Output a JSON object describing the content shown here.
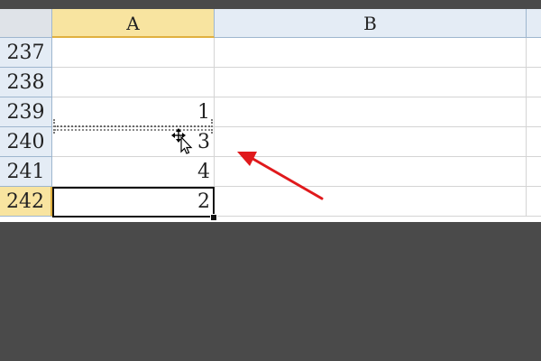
{
  "columns": [
    {
      "label": "A"
    },
    {
      "label": "B"
    }
  ],
  "rows": [
    {
      "number": "237",
      "a": ""
    },
    {
      "number": "238",
      "a": ""
    },
    {
      "number": "239",
      "a": "1"
    },
    {
      "number": "240",
      "a": "3"
    },
    {
      "number": "241",
      "a": "4"
    },
    {
      "number": "242",
      "a": "2"
    }
  ],
  "selection": {
    "active_row": "242",
    "active_column": "A"
  },
  "colors": {
    "selected_header": "#f8e4a0",
    "header": "#e4ecf5",
    "annotation_arrow": "#e0191c",
    "background": "#4a4a4a"
  },
  "icons": {
    "cursor": "move-cursor-icon",
    "annotation": "red-arrow-annotation"
  }
}
